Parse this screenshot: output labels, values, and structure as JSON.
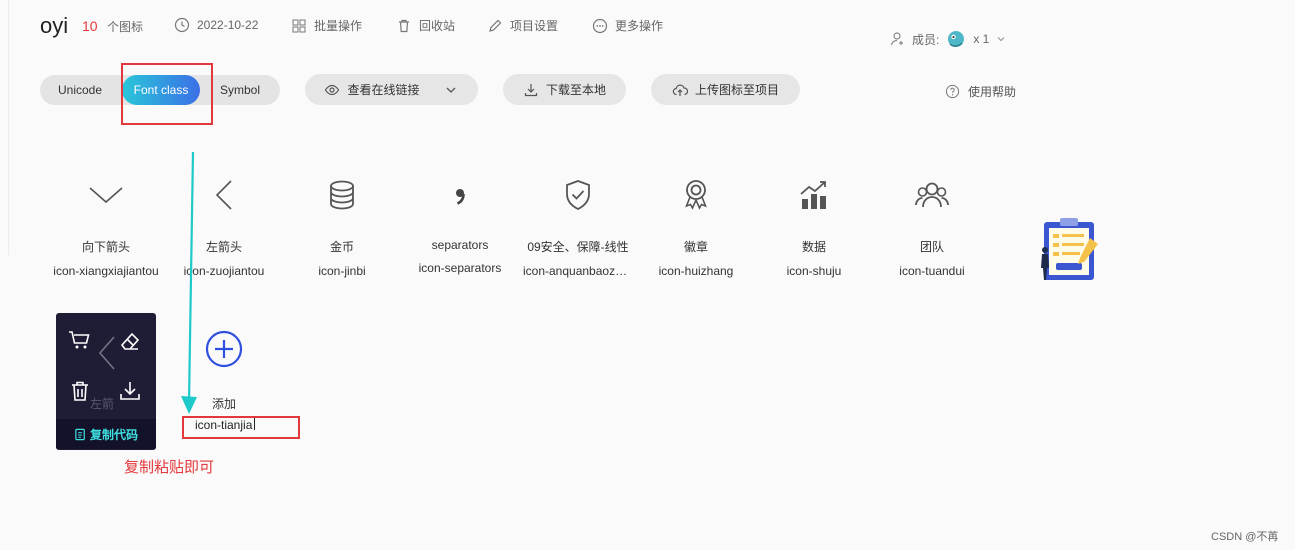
{
  "project": {
    "name": "oyi",
    "icon_count": "10",
    "icon_count_label": "个图标"
  },
  "meta": {
    "date": "2022-10-22",
    "batch": "批量操作",
    "recycle": "回收站",
    "settings": "项目设置",
    "more": "更多操作"
  },
  "members": {
    "label": "成员:",
    "count": "x 1"
  },
  "toolbar": {
    "tabs": [
      "Unicode",
      "Font class",
      "Symbol"
    ],
    "view_online": "查看在线链接",
    "download": "下载至本地",
    "upload": "上传图标至项目",
    "help": "使用帮助"
  },
  "icons": [
    {
      "name": "向下箭头",
      "cls": "icon-xiangxiajiantou",
      "glyph": "chevron-down-icon"
    },
    {
      "name": "左箭头",
      "cls": "icon-zuojiantou",
      "glyph": "chevron-left-icon"
    },
    {
      "name": "金币",
      "cls": "icon-jinbi",
      "glyph": "coins-icon"
    },
    {
      "name": "separators",
      "cls": "icon-separators",
      "glyph": "comma-icon"
    },
    {
      "name": "09安全、保障-线性",
      "cls": "icon-anquanbaozhang",
      "glyph": "shield-check-icon"
    },
    {
      "name": "徽章",
      "cls": "icon-huizhang",
      "glyph": "badge-icon"
    },
    {
      "name": "数据",
      "cls": "icon-shuju",
      "glyph": "chart-icon"
    },
    {
      "name": "团队",
      "cls": "icon-tuandui",
      "glyph": "team-icon"
    }
  ],
  "add_item": {
    "name": "添加",
    "cls": "icon-tianjia"
  },
  "hover_card": {
    "copy_label": "复制代码",
    "behind_label": "左箭"
  },
  "annotation": {
    "text": "复制粘贴即可"
  },
  "watermark": "CSDN @不苒",
  "colors": {
    "accent_start": "#29c7d9",
    "accent_end": "#3b6fe7",
    "annotation_red": "#e4393c",
    "arrow_teal": "#1ec9c9"
  }
}
